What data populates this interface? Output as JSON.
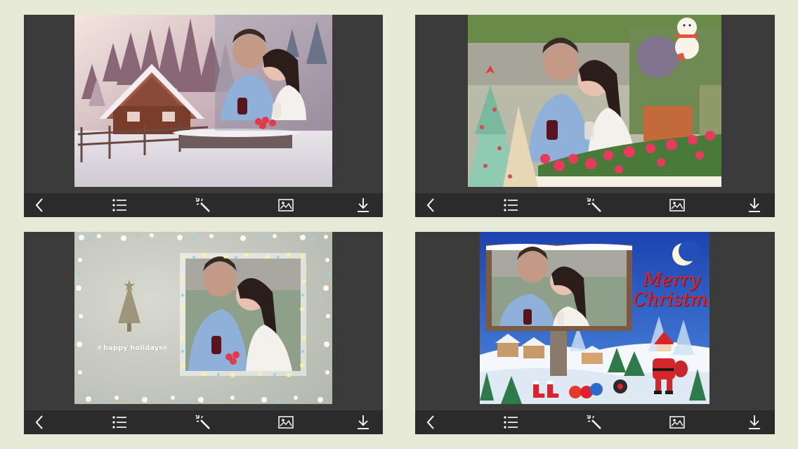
{
  "toolbar": {
    "buttons": [
      {
        "name": "back",
        "icon": "chevron-left-icon"
      },
      {
        "name": "frames-list",
        "icon": "list-icon"
      },
      {
        "name": "effects",
        "icon": "magic-wand-icon"
      },
      {
        "name": "gallery",
        "icon": "image-icon"
      },
      {
        "name": "save",
        "icon": "download-icon"
      }
    ]
  },
  "frames": [
    {
      "id": 1,
      "theme": "winter cabin"
    },
    {
      "id": 2,
      "theme": "christmas tree and snowman"
    },
    {
      "id": 3,
      "theme": "snowflake border",
      "greeting": "happy holidays"
    },
    {
      "id": 4,
      "theme": "santa billboard",
      "greeting_line1": "Merry",
      "greeting_line2": "Christmas"
    }
  ],
  "colors": {
    "background": "#e6ead6",
    "panel": "#3b3b3b",
    "toolbar": "#2b2b2b",
    "icon": "#ffffff",
    "christmas_red": "#e0252b"
  }
}
